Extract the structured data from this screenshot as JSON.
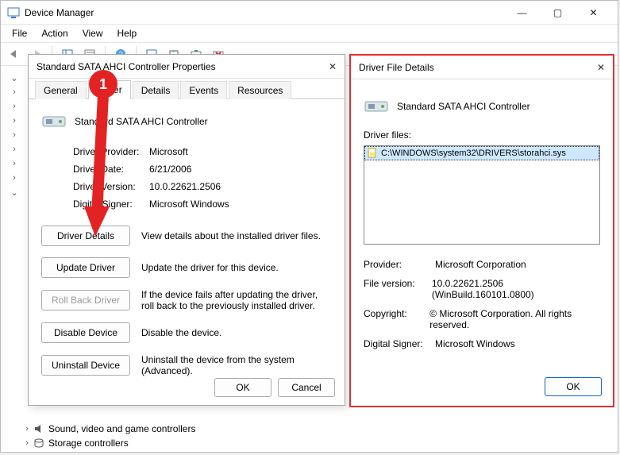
{
  "window": {
    "title": "Device Manager",
    "menu": {
      "file": "File",
      "action": "Action",
      "view": "View",
      "help": "Help"
    },
    "win_controls": {
      "min": "—",
      "max": "▢",
      "close": "✕"
    }
  },
  "tree": {
    "bottom_items": [
      {
        "label": "Sound, video and game controllers"
      },
      {
        "label": "Storage controllers"
      }
    ]
  },
  "props": {
    "title": "Standard SATA AHCI Controller Properties",
    "tabs": {
      "general": "General",
      "driver": "Driver",
      "details": "Details",
      "events": "Events",
      "resources": "Resources"
    },
    "device_name": "Standard SATA AHCI Controller",
    "rows": {
      "provider_k": "Driver Provider:",
      "provider_v": "Microsoft",
      "date_k": "Driver Date:",
      "date_v": "6/21/2006",
      "version_k": "Driver Version:",
      "version_v": "10.0.22621.2506",
      "signer_k": "Digital Signer:",
      "signer_v": "Microsoft Windows"
    },
    "buttons": {
      "details": "Driver Details",
      "details_desc": "View details about the installed driver files.",
      "update": "Update Driver",
      "update_desc": "Update the driver for this device.",
      "rollback": "Roll Back Driver",
      "rollback_desc": "If the device fails after updating the driver, roll back to the previously installed driver.",
      "disable": "Disable Device",
      "disable_desc": "Disable the device.",
      "uninstall": "Uninstall Device",
      "uninstall_desc": "Uninstall the device from the system (Advanced).",
      "ok": "OK",
      "cancel": "Cancel"
    }
  },
  "details": {
    "title": "Driver File Details",
    "device_name": "Standard SATA AHCI Controller",
    "files_label": "Driver files:",
    "files": [
      "C:\\WINDOWS\\system32\\DRIVERS\\storahci.sys"
    ],
    "rows": {
      "provider_k": "Provider:",
      "provider_v": "Microsoft Corporation",
      "version_k": "File version:",
      "version_v": "10.0.22621.2506 (WinBuild.160101.0800)",
      "copyright_k": "Copyright:",
      "copyright_v": "© Microsoft Corporation. All rights reserved.",
      "signer_k": "Digital Signer:",
      "signer_v": "Microsoft Windows"
    },
    "ok": "OK"
  },
  "annotation": {
    "step": "1"
  }
}
